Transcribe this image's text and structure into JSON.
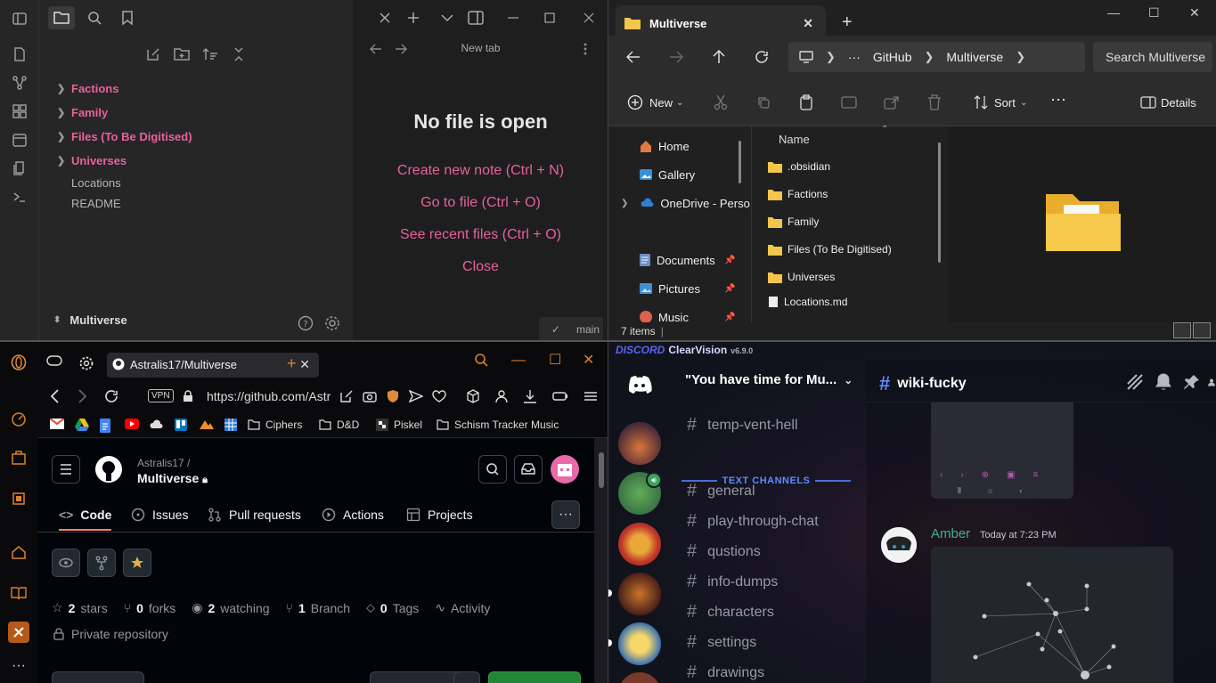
{
  "obsidian": {
    "tree": [
      {
        "label": "Factions",
        "type": "folder"
      },
      {
        "label": "Family",
        "type": "folder"
      },
      {
        "label": "Files (To Be Digitised)",
        "type": "folder"
      },
      {
        "label": "Universes",
        "type": "folder"
      },
      {
        "label": "Locations",
        "type": "file"
      },
      {
        "label": "README",
        "type": "file"
      }
    ],
    "vault_name": "Multiverse",
    "tab_title": "New tab",
    "empty_title": "No file is open",
    "links": [
      "Create new note (Ctrl + N)",
      "Go to file (Ctrl + O)",
      "See recent files (Ctrl + O)",
      "Close"
    ],
    "branch": "main",
    "accent": "#e6629b"
  },
  "explorer": {
    "tab_title": "Multiverse",
    "breadcrumbs": [
      "GitHub",
      "Multiverse"
    ],
    "search_placeholder": "Search Multiverse",
    "new_label": "New",
    "sort_label": "Sort",
    "details_label": "Details",
    "nav": [
      {
        "label": "Home",
        "icon": "home-icon"
      },
      {
        "label": "Gallery",
        "icon": "gallery-icon"
      },
      {
        "label": "OneDrive - Perso",
        "icon": "onedrive-icon"
      },
      {
        "label": "Documents",
        "icon": "documents-icon"
      },
      {
        "label": "Pictures",
        "icon": "pictures-icon"
      },
      {
        "label": "Music",
        "icon": "music-icon"
      }
    ],
    "column_name": "Name",
    "files": [
      ".obsidian",
      "Factions",
      "Family",
      "Files (To Be Digitised)",
      "Universes",
      "Locations.md"
    ],
    "status": "7 items"
  },
  "browser": {
    "tab_title": "Astralis17/Multiverse",
    "url": "https://github.com/Astr",
    "vpn": "VPN",
    "bookmarks": [
      "Ciphers",
      "D&D",
      "Piskel",
      "Schism Tracker Music"
    ],
    "github": {
      "owner": "Astralis17 /",
      "repo": "Multiverse",
      "nav": [
        "Code",
        "Issues",
        "Pull requests",
        "Actions",
        "Projects"
      ],
      "stars_n": "2",
      "stars_l": "stars",
      "forks_n": "0",
      "forks_l": "forks",
      "watching_n": "2",
      "watching_l": "watching",
      "branch_n": "1",
      "branch_l": "Branch",
      "tags_n": "0",
      "tags_l": "Tags",
      "activity": "Activity",
      "private": "Private repository"
    }
  },
  "discord": {
    "brand": "DISCORD",
    "theme": "ClearVision",
    "version": "v6.9.0",
    "guild_name": "\"You have time for Mu...",
    "category": "TEXT CHANNELS",
    "top_channel": "temp-vent-hell",
    "channels": [
      "general",
      "play-through-chat",
      "qustions",
      "info-dumps",
      "characters",
      "settings",
      "drawings"
    ],
    "current_channel": "wiki-fucky",
    "author": "Amber",
    "timestamp": "Today at 7:23 PM"
  }
}
